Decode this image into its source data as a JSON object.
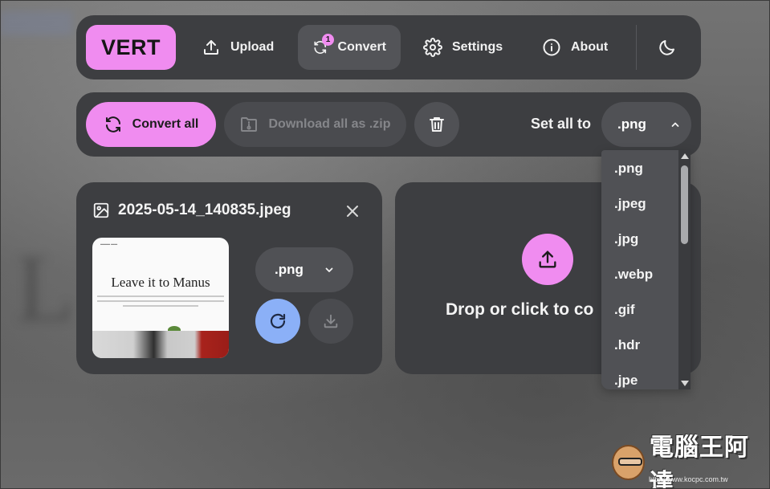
{
  "app": {
    "logo": "VERT"
  },
  "nav": {
    "items": [
      {
        "label": "Upload",
        "icon": "upload-icon"
      },
      {
        "label": "Convert",
        "icon": "refresh-icon",
        "badge": "1",
        "active": true
      },
      {
        "label": "Settings",
        "icon": "gear-icon"
      },
      {
        "label": "About",
        "icon": "info-icon"
      }
    ],
    "theme_icon": "moon-icon"
  },
  "actions": {
    "convert_all": "Convert all",
    "download_zip": "Download all as .zip",
    "set_all_label": "Set all to",
    "set_all_value": ".png"
  },
  "file": {
    "name": "2025-05-14_140835.jpeg",
    "format": ".png",
    "thumbnail_title": "Leave it to Manus"
  },
  "dropzone": {
    "text": "Drop or click to co"
  },
  "format_options": [
    ".png",
    ".jpeg",
    ".jpg",
    ".webp",
    ".gif",
    ".hdr",
    ".jpe"
  ],
  "watermark": {
    "text": "電腦王阿達",
    "url": "http://www.kocpc.com.tw"
  },
  "colors": {
    "accent_pink": "#f08cf0",
    "accent_blue": "#8bb0f7",
    "panel": "#3d3e41",
    "control": "#505155"
  }
}
